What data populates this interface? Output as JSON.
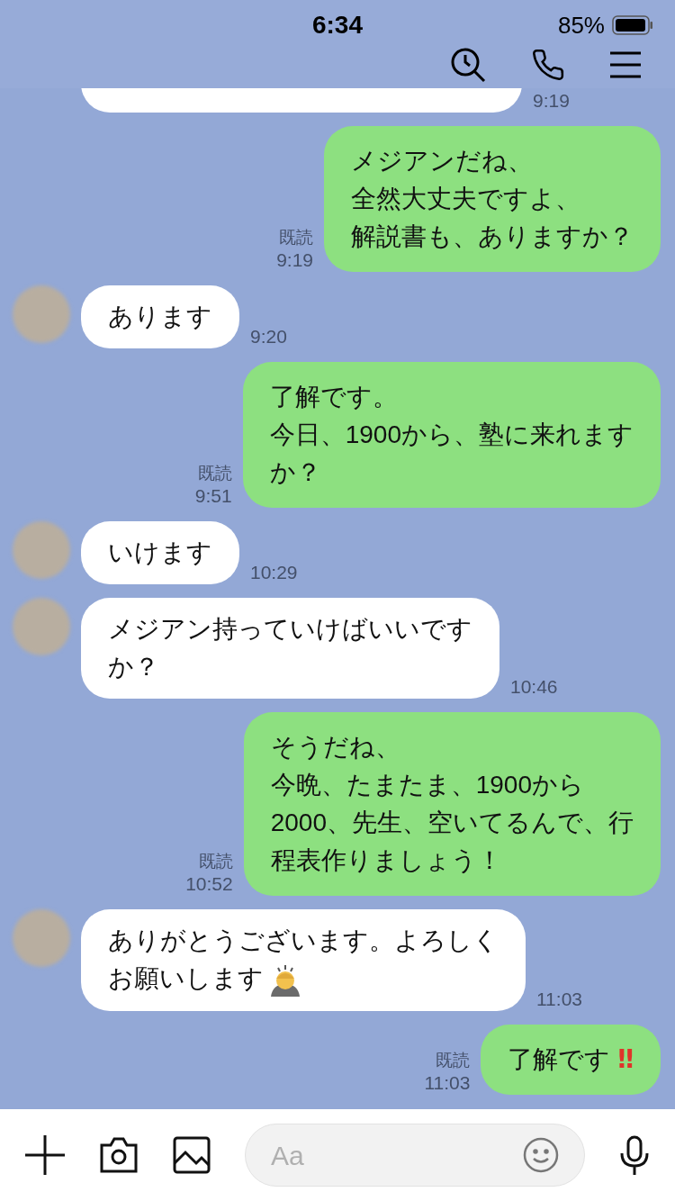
{
  "status_bar": {
    "time": "6:34",
    "battery": "85%"
  },
  "messages": [
    {
      "kind": "received",
      "time": "9:19"
    },
    {
      "kind": "sent",
      "lines": [
        "メジアンだね、",
        "全然大丈夫ですよ、",
        "解説書も、ありますか？"
      ],
      "read_label": "既読",
      "time": "9:19"
    },
    {
      "kind": "received",
      "lines": [
        "あります"
      ],
      "time": "9:20"
    },
    {
      "kind": "sent",
      "lines": [
        "了解です。",
        "今日、1900から、塾に来れます",
        "か？"
      ],
      "read_label": "既読",
      "time": "9:51"
    },
    {
      "kind": "received",
      "lines": [
        "いけます"
      ],
      "time": "10:29"
    },
    {
      "kind": "received",
      "lines": [
        "メジアン持っていけばいいです",
        "か？"
      ],
      "time": "10:46"
    },
    {
      "kind": "sent",
      "lines": [
        "そうだね、",
        "今晩、たまたま、1900から",
        "2000、先生、空いてるんで、行",
        "程表作りましょう！"
      ],
      "read_label": "既読",
      "time": "10:52"
    },
    {
      "kind": "received",
      "lines": [
        "ありがとうございます。よろしく",
        "お願いします"
      ],
      "bow_emoji": true,
      "time": "11:03"
    },
    {
      "kind": "sent",
      "lines": [
        "了解です"
      ],
      "mark": "‼",
      "read_label": "既読",
      "time": "11:03"
    }
  ],
  "composer": {
    "placeholder": "Aa"
  }
}
